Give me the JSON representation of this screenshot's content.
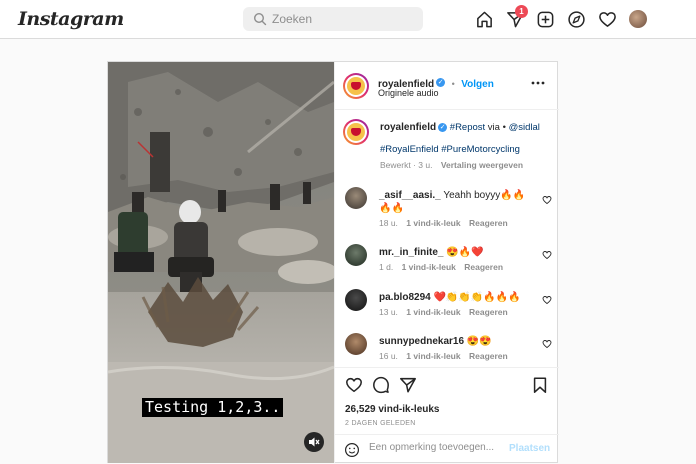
{
  "topbar": {
    "logo": "Instagram",
    "search_placeholder": "Zoeken",
    "notification_count": "1",
    "icons": [
      "home-icon",
      "direct-icon",
      "new-post-icon",
      "explore-icon",
      "activity-heart-icon",
      "profile-avatar"
    ]
  },
  "post": {
    "video_caption": "Testing 1,2,3..",
    "header": {
      "username": "royalenfield",
      "separator": "•",
      "follow_label": "Volgen",
      "audio": "Originele audio"
    },
    "caption": {
      "username": "royalenfield",
      "text_tag": "#Repost",
      "text_via": " via • ",
      "mention": "@sidlal",
      "hashtags": "#RoyalEnfield #PureMotorcycling",
      "edited": "Bewerkt · 3 u.",
      "translate": "Vertaling weergeven"
    },
    "comments": [
      {
        "username": "_asif__aasi._",
        "text": " Yeahh boyyy🔥🔥🔥🔥",
        "time": "18 u.",
        "likes": "1 vind-ik-leuk",
        "reply": "Reageren"
      },
      {
        "username": "mr._in_finite_",
        "text": " 😍🔥❤️",
        "time": "1 d.",
        "likes": "1 vind-ik-leuk",
        "reply": "Reageren"
      },
      {
        "username": "pa.blo8294",
        "text": " ❤️👏👏👏🔥🔥🔥",
        "time": "13 u.",
        "likes": "1 vind-ik-leuk",
        "reply": "Reageren"
      },
      {
        "username": "sunnypednekar16",
        "text": " 😍😍",
        "time": "16 u.",
        "likes": "1 vind-ik-leuk",
        "reply": "Reageren"
      }
    ],
    "likes": "26,529 vind-ik-leuks",
    "date": "2 DAGEN GELEDEN",
    "comment_placeholder": "Een opmerking toevoegen...",
    "post_button": "Plaatsen"
  },
  "colors": {
    "accent": "#0095f6",
    "badge": "#ed4956",
    "post_disabled": "#b2dffc"
  }
}
